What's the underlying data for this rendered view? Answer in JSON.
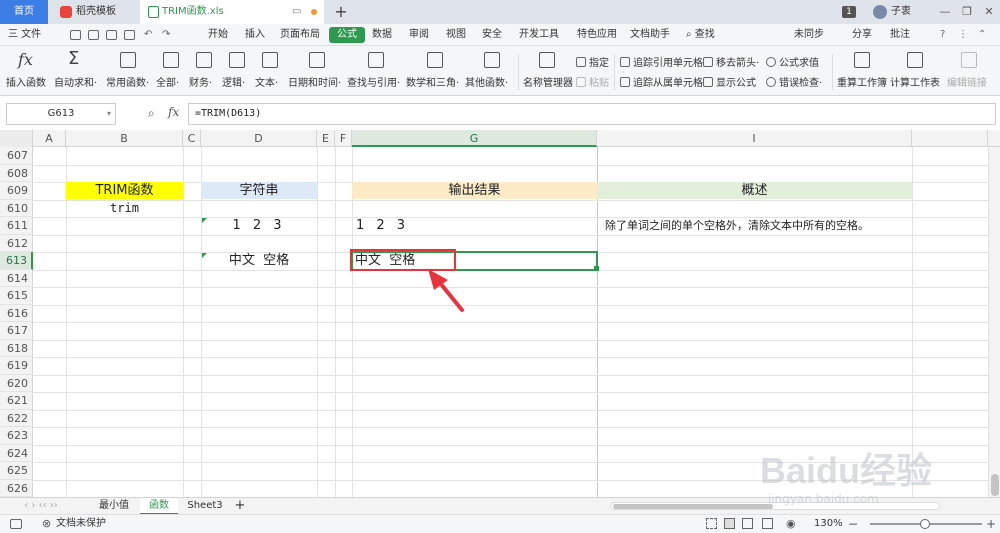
{
  "tabs": {
    "home": "首页",
    "template": "稻壳模板",
    "file": "TRIM函数.xls",
    "add": "+"
  },
  "window": {
    "badge": "1",
    "user": "子衷",
    "controls": [
      "—",
      "❐",
      "✕"
    ]
  },
  "menubar": {
    "file_menu": "三 文件",
    "items": [
      "开始",
      "插入",
      "页面布局",
      "公式",
      "数据",
      "审阅",
      "视图",
      "安全",
      "开发工具",
      "特色应用",
      "文档助手"
    ],
    "search": "查找",
    "sync": "未同步",
    "share": "分享",
    "comment": "批注"
  },
  "ribbon": {
    "big_buttons": [
      "插入函数",
      "自动求和·",
      "常用函数·",
      "全部·",
      "财务·",
      "逻辑·",
      "文本·",
      "日期和时间·",
      "查找与引用·",
      "数学和三角·",
      "其他函数·",
      "名称管理器"
    ],
    "small_buttons": {
      "assign": "指定",
      "paste": "粘贴",
      "trace_precedents": "追踪引用单元格",
      "trace_dependents": "追踪从属单元格",
      "remove_arrows": "移去箭头·",
      "show_formula": "显示公式",
      "eval_formula": "公式求值",
      "error_check": "错误检查·"
    },
    "right_buttons": [
      "重算工作簿",
      "计算工作表",
      "编辑链接"
    ]
  },
  "formula_bar": {
    "name_box": "G613",
    "fx": "fx",
    "formula": "=TRIM(D613)"
  },
  "columns": [
    "A",
    "B",
    "C",
    "D",
    "E",
    "F",
    "G",
    "I"
  ],
  "selected_column": "G",
  "rows": [
    "607",
    "608",
    "609",
    "610",
    "611",
    "612",
    "613",
    "614",
    "615",
    "616",
    "617",
    "618",
    "619",
    "620",
    "621",
    "622",
    "623",
    "624",
    "625",
    "626"
  ],
  "selected_row": "613",
  "cells": {
    "b609": "TRIM函数",
    "b610": "trim",
    "d609": "字符串",
    "g609": "输出结果",
    "i609": "概述",
    "d611": "1 2 3",
    "g611": "1 2 3",
    "i611": "除了单词之间的单个空格外，清除文本中所有的空格。",
    "d613": "中文  空格",
    "g613": "中文  空格"
  },
  "colors": {
    "b609_fill": "#ffff00",
    "d609_fill": "#dde9f6",
    "g609_fill": "#fdebc8",
    "i609_fill": "#e2efda",
    "accent_green": "#2e9a4f",
    "annotation_red": "#e8323c"
  },
  "sheet_tabs": [
    "最小值",
    "函数",
    "Sheet3"
  ],
  "active_sheet": "函数",
  "status": {
    "protect": "文档未保护",
    "zoom": "130%"
  },
  "watermark": {
    "brand": "Baidu经验",
    "url": "jingyan.baidu.com"
  }
}
